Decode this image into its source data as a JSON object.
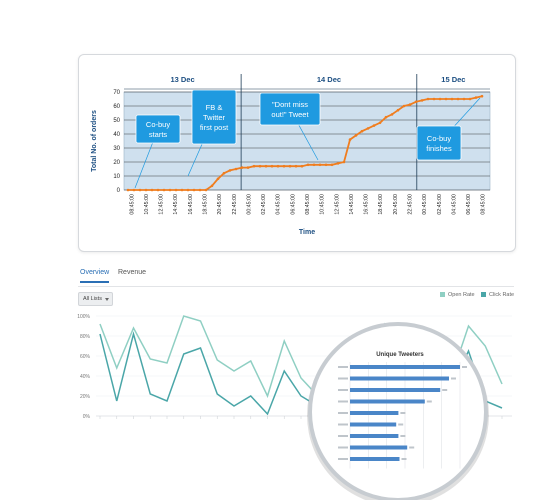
{
  "tabs": {
    "overview": "Overview",
    "revenue": "Revenue"
  },
  "list_filter": {
    "selected": "All Lists"
  },
  "chart_data": [
    {
      "type": "line",
      "xlabel": "Time",
      "ylabel": "Total No. of orders",
      "ylim": [
        0,
        70
      ],
      "yticks": [
        0,
        10,
        20,
        30,
        40,
        50,
        60,
        70
      ],
      "day_groups": [
        {
          "label": "13 Dec",
          "start": 0,
          "end": 8
        },
        {
          "label": "14 Dec",
          "start": 8,
          "end": 20
        },
        {
          "label": "15 Dec",
          "start": 20,
          "end": 25
        }
      ],
      "x": [
        "08:45:00",
        "10:45:00",
        "12:45:00",
        "14:45:00",
        "16:45:00",
        "18:45:00",
        "20:45:00",
        "22:45:00",
        "00:45:00",
        "02:45:00",
        "04:45:00",
        "06:45:00",
        "08:45:00",
        "10:45:00",
        "12:45:00",
        "14:45:00",
        "16:45:00",
        "18:45:00",
        "20:45:00",
        "22:45:00",
        "00:45:00",
        "02:45:00",
        "04:45:00",
        "06:45:00",
        "08:45:00"
      ],
      "series": [
        {
          "color": "#f07d1e",
          "values": [
            0,
            0,
            0,
            0,
            0,
            0,
            0,
            0,
            0,
            0,
            0,
            0,
            0,
            0,
            3,
            8,
            12,
            14,
            15,
            16,
            16,
            17,
            17,
            17,
            17,
            17,
            17,
            17,
            17,
            17,
            18,
            18,
            18,
            18,
            18,
            19,
            20,
            36,
            39,
            42,
            44,
            46,
            48,
            52,
            54,
            57,
            60,
            61,
            63,
            64,
            65,
            65,
            65,
            65,
            65,
            65,
            65,
            65,
            66,
            67
          ]
        }
      ],
      "annotations": [
        {
          "text": "Co-buy starts"
        },
        {
          "text": "FB & Twitter first post"
        },
        {
          "text": "\"Dont miss out!\" Tweet"
        },
        {
          "text": "Co-buy finishes"
        }
      ],
      "grid": true
    },
    {
      "type": "line",
      "ylim": [
        0,
        100
      ],
      "yticks": [
        "0%",
        "20%",
        "40%",
        "60%",
        "80%",
        "100%"
      ],
      "legend": "top-right",
      "series": [
        {
          "name": "Open Rate",
          "color": "#8fcfc3",
          "values": [
            92,
            48,
            88,
            57,
            53,
            100,
            95,
            56,
            45,
            55,
            20,
            75,
            38,
            20,
            40,
            40,
            60,
            92,
            70,
            42,
            45,
            40,
            90,
            70,
            32
          ]
        },
        {
          "name": "Click Rate",
          "color": "#4aa6a8",
          "values": [
            82,
            15,
            82,
            22,
            15,
            62,
            68,
            22,
            10,
            20,
            2,
            45,
            20,
            10,
            5,
            55,
            22,
            65,
            55,
            25,
            5,
            30,
            65,
            15,
            8
          ]
        }
      ]
    },
    {
      "type": "bar",
      "orientation": "horizontal",
      "title": "Unique Tweeters",
      "color": "#4a86c8",
      "values": [
        100,
        90,
        82,
        68,
        44,
        42,
        44,
        52,
        45
      ]
    }
  ]
}
